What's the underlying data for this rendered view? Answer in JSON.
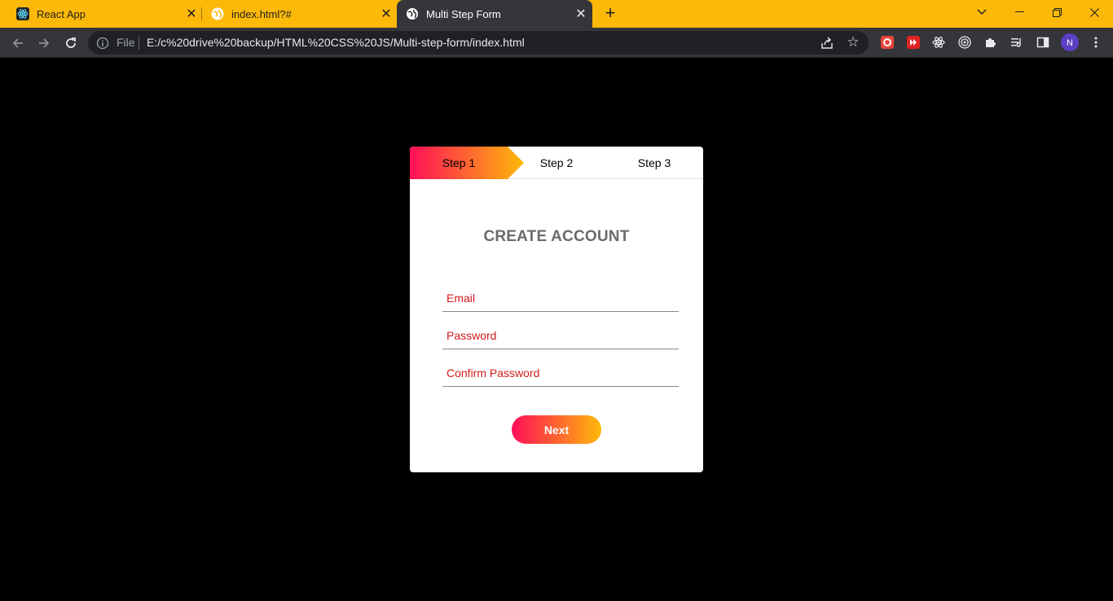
{
  "browser": {
    "tabs": [
      {
        "title": "React App",
        "favicon": "react-icon",
        "active": false
      },
      {
        "title": "index.html?#",
        "favicon": "globe-icon",
        "active": false
      },
      {
        "title": "Multi Step Form",
        "favicon": "globe-icon",
        "active": true
      }
    ],
    "omnibox": {
      "scheme_label": "File",
      "url": "E:/c%20drive%20backup/HTML%20CSS%20JS/Multi-step-form/index.html"
    },
    "profile_initial": "N",
    "colors": {
      "tabstrip": "#FDB90A",
      "toolbar": "#35363A",
      "omnibox": "#202124",
      "profile": "#5B3FC4"
    }
  },
  "form": {
    "steps": [
      {
        "label": "Step 1",
        "active": true
      },
      {
        "label": "Step 2",
        "active": false
      },
      {
        "label": "Step 3",
        "active": false
      }
    ],
    "title": "CREATE ACCOUNT",
    "fields": {
      "email_placeholder": "Email",
      "password_placeholder": "Password",
      "confirm_placeholder": "Confirm Password"
    },
    "next_label": "Next",
    "gradient": {
      "start": "#FF0F58",
      "end": "#FDB90A"
    }
  }
}
